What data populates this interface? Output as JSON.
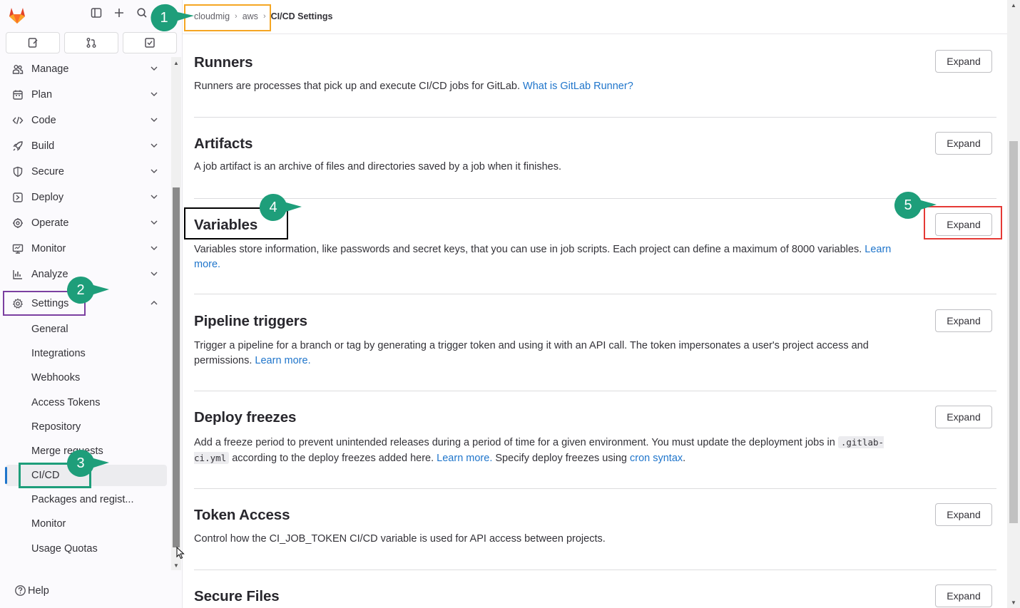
{
  "header": {
    "breadcrumb": [
      "cloudmig",
      "aws",
      "CI/CD Settings"
    ]
  },
  "sidebar": {
    "nav": [
      {
        "label": "Manage",
        "icon": "users-icon"
      },
      {
        "label": "Plan",
        "icon": "calendar-icon"
      },
      {
        "label": "Code",
        "icon": "code-icon"
      },
      {
        "label": "Build",
        "icon": "rocket-icon"
      },
      {
        "label": "Secure",
        "icon": "shield-icon"
      },
      {
        "label": "Deploy",
        "icon": "deployments-icon"
      },
      {
        "label": "Operate",
        "icon": "cloud-gear-icon"
      },
      {
        "label": "Monitor",
        "icon": "monitor-icon"
      },
      {
        "label": "Analyze",
        "icon": "chart-icon"
      },
      {
        "label": "Settings",
        "icon": "gear-icon"
      }
    ],
    "settings_items": [
      "General",
      "Integrations",
      "Webhooks",
      "Access Tokens",
      "Repository",
      "Merge requests",
      "CI/CD",
      "Packages and regist...",
      "Monitor",
      "Usage Quotas"
    ],
    "active_item": "CI/CD",
    "help_label": "Help"
  },
  "sections": [
    {
      "title": "Runners",
      "desc": "Runners are processes that pick up and execute CI/CD jobs for GitLab.",
      "link": "What is GitLab Runner?",
      "button": "Expand"
    },
    {
      "title": "Artifacts",
      "desc": "A job artifact is an archive of files and directories saved by a job when it finishes.",
      "button": "Expand"
    },
    {
      "title": "Variables",
      "desc": "Variables store information, like passwords and secret keys, that you can use in job scripts. Each project can define a maximum of 8000 variables.",
      "link": "Learn more.",
      "button": "Expand"
    },
    {
      "title": "Pipeline triggers",
      "desc": "Trigger a pipeline for a branch or tag by generating a trigger token and using it with an API call. The token impersonates a user's project access and permissions.",
      "link": "Learn more.",
      "button": "Expand"
    },
    {
      "title": "Deploy freezes",
      "desc_a": "Add a freeze period to prevent unintended releases during a period of time for a given environment. You must update the deployment jobs in",
      "code": ".gitlab-ci.yml",
      "desc_b": "according to the deploy freezes added here.",
      "link": "Learn more.",
      "desc_c": "Specify deploy freezes using",
      "link2": "cron syntax",
      "desc_d": ".",
      "button": "Expand"
    },
    {
      "title": "Token Access",
      "desc": "Control how the CI_JOB_TOKEN CI/CD variable is used for API access between projects.",
      "button": "Expand"
    },
    {
      "title": "Secure Files",
      "button": "Expand"
    }
  ],
  "annotations": {
    "badges": [
      "1",
      "2",
      "3",
      "4",
      "5"
    ],
    "colors": {
      "badge": "#1e9e7a",
      "box1": "#f5a623",
      "box2": "#7b3fa0",
      "box3": "#1e9e7a",
      "box4": "#000000",
      "box5": "#e53935"
    }
  }
}
